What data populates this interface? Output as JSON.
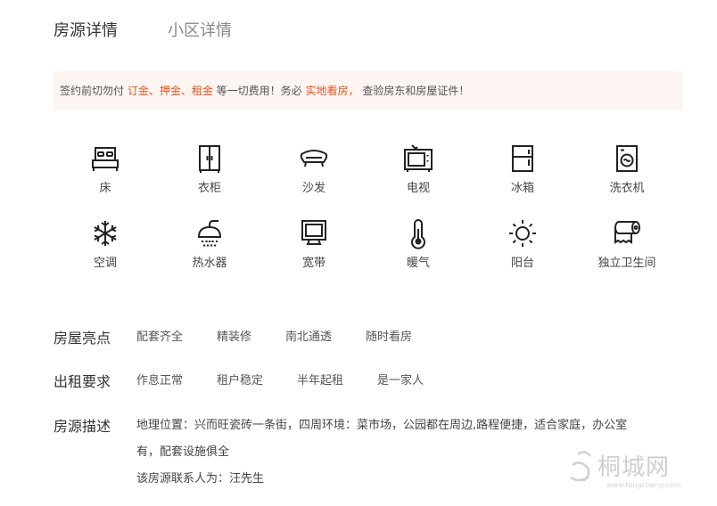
{
  "tabs": [
    {
      "label": "房源详情"
    },
    {
      "label": "小区详情"
    }
  ],
  "notice": {
    "p1": "签约前切勿付 ",
    "h1": "订金、押金、租金",
    "p2": " 等一切费用！务必 ",
    "h2": "实地看房，",
    "p3": " 查验房东和房屋证件！",
    "text_color": "#555555",
    "highlight_color": "#e8541e",
    "background": "#fdf5f1"
  },
  "facilities": [
    {
      "label": "床",
      "icon": "bed-icon"
    },
    {
      "label": "衣柜",
      "icon": "wardrobe-icon"
    },
    {
      "label": "沙发",
      "icon": "sofa-icon"
    },
    {
      "label": "电视",
      "icon": "tv-icon"
    },
    {
      "label": "冰箱",
      "icon": "fridge-icon"
    },
    {
      "label": "洗衣机",
      "icon": "washing-machine-icon"
    },
    {
      "label": "空调",
      "icon": "snowflake-icon"
    },
    {
      "label": "热水器",
      "icon": "shower-icon"
    },
    {
      "label": "宽带",
      "icon": "monitor-icon"
    },
    {
      "label": "暖气",
      "icon": "thermometer-icon"
    },
    {
      "label": "阳台",
      "icon": "sun-icon"
    },
    {
      "label": "独立卫生间",
      "icon": "toilet-paper-icon"
    }
  ],
  "highlights": {
    "title": "房屋亮点",
    "tags": [
      "配套齐全",
      "精装修",
      "南北通透",
      "随时看房"
    ]
  },
  "requirements": {
    "title": "出租要求",
    "tags": [
      "作息正常",
      "租户稳定",
      "半年起租",
      "是一家人"
    ]
  },
  "description": {
    "title": "房源描述",
    "line1": "地理位置：兴而旺瓷砖一条街，四周环境：菜市场，公园都在周边,路程便捷，适合家庭，办公室",
    "line2": "有，配套设施俱全",
    "contact": "该房源联系人为：汪先生"
  },
  "watermark": {
    "brand": "桐城网",
    "url": "www.tongcheng.com"
  }
}
